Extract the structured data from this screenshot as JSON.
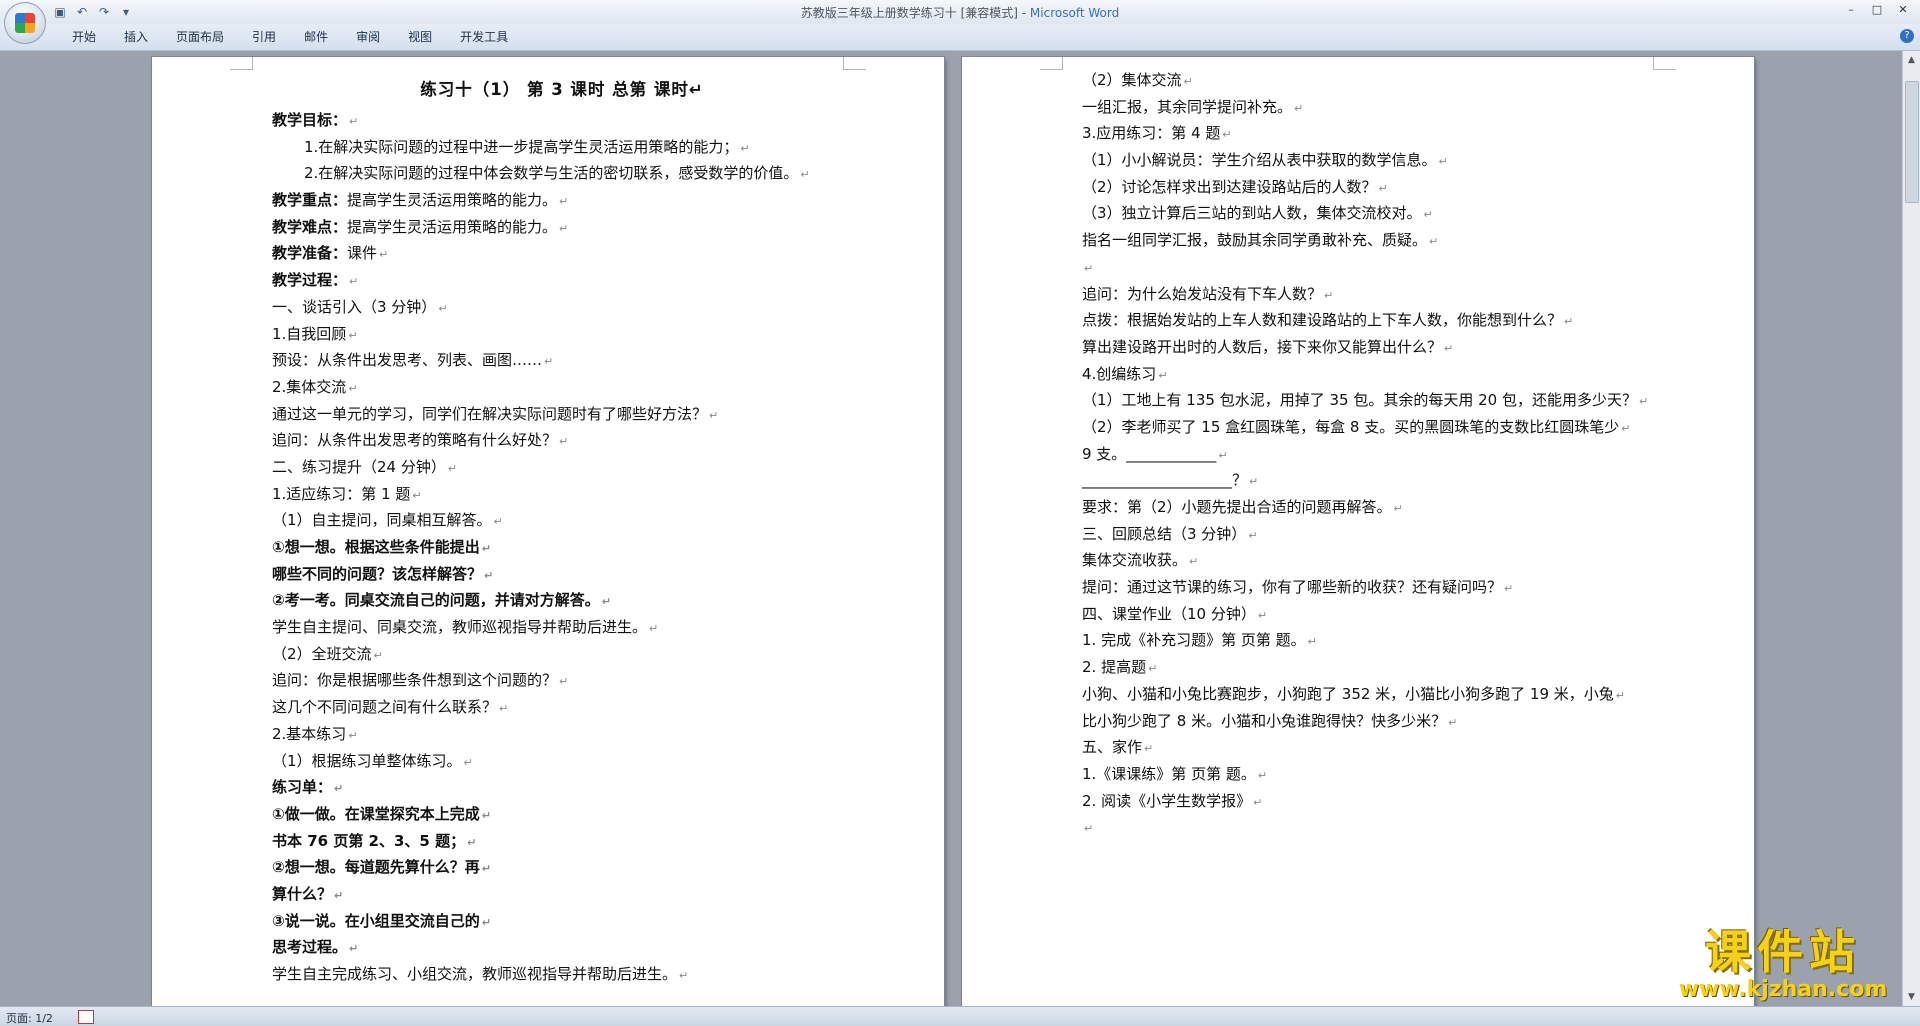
{
  "window": {
    "title_doc": "苏教版三年级上册数学练习十 [兼容模式] - ",
    "title_app": "Microsoft Word",
    "qat": [
      "save-icon",
      "undo-icon",
      "redo-icon",
      "customize-icon"
    ],
    "controls": [
      "–",
      "□",
      "✕"
    ]
  },
  "ribbon": {
    "tabs": [
      "开始",
      "插入",
      "页面布局",
      "引用",
      "邮件",
      "审阅",
      "视图",
      "开发工具"
    ],
    "help": "?"
  },
  "left_page": {
    "title": "练习十（1）    第 3 课时   总第   课时",
    "lines": [
      {
        "text": "教学目标：",
        "bold_prefix": true
      },
      {
        "text": "1.在解决实际问题的过程中进一步提高学生灵活运用策略的能力；",
        "indent": true
      },
      {
        "text": "2.在解决实际问题的过程中体会数学与生活的密切联系，感受数学的价值。",
        "indent": true
      },
      {
        "prefix": "教学重点：",
        "text": "提高学生灵活运用策略的能力。"
      },
      {
        "prefix": "教学难点：",
        "text": "提高学生灵活运用策略的能力。"
      },
      {
        "prefix": "教学准备：",
        "text": "课件"
      },
      {
        "prefix": "教学过程：",
        "text": ""
      },
      {
        "text": "一、谈话引入（3 分钟）"
      },
      {
        "text": "1.自我回顾"
      },
      {
        "text": "预设：从条件出发思考、列表、画图……"
      },
      {
        "text": "2.集体交流"
      },
      {
        "text": "通过这一单元的学习，同学们在解决实际问题时有了哪些好方法？"
      },
      {
        "text": "追问：从条件出发思考的策略有什么好处？"
      },
      {
        "text": "二、练习提升（24 分钟）"
      },
      {
        "text": "1.适应练习：第 1 题"
      },
      {
        "text": "（1）自主提问，同桌相互解答。"
      },
      {
        "text": "①想一想。根据这些条件能提出",
        "bold": true
      },
      {
        "text": "哪些不同的问题？该怎样解答？",
        "bold": true
      },
      {
        "text": "②考一考。同桌交流自己的问题，并请对方解答。",
        "bold": true
      },
      {
        "text": "学生自主提问、同桌交流，教师巡视指导并帮助后进生。"
      },
      {
        "text": "（2）全班交流"
      },
      {
        "text": "追问：你是根据哪些条件想到这个问题的？"
      },
      {
        "text": "这几个不同问题之间有什么联系？"
      },
      {
        "text": "2.基本练习"
      },
      {
        "text": "（1）根据练习单整体练习。"
      },
      {
        "text": "练习单：",
        "bold": true
      },
      {
        "text": "①做一做。在课堂探究本上完成",
        "bold": true
      },
      {
        "text": "书本 76 页第 2、3、5 题；",
        "bold": true
      },
      {
        "text": "②想一想。每道题先算什么？再",
        "bold": true
      },
      {
        "text": "算什么？",
        "bold": true
      },
      {
        "text": "③说一说。在小组里交流自己的",
        "bold": true
      },
      {
        "text": "思考过程。",
        "bold": true
      },
      {
        "text": "学生自主完成练习、小组交流，教师巡视指导并帮助后进生。"
      }
    ]
  },
  "right_page": {
    "lines": [
      {
        "text": "（2）集体交流"
      },
      {
        "text": "一组汇报，其余同学提问补充。"
      },
      {
        "text": "3.应用练习：第 4 题"
      },
      {
        "text": "（1）小小解说员：学生介绍从表中获取的数学信息。"
      },
      {
        "text": "（2）讨论怎样求出到达建设路站后的人数？"
      },
      {
        "text": "（3）独立计算后三站的到站人数，集体交流校对。"
      },
      {
        "text": "指名一组同学汇报，鼓励其余同学勇敢补充、质疑。"
      },
      {
        "text": ""
      },
      {
        "text": "追问：为什么始发站没有下车人数？"
      },
      {
        "text": "点拨：根据始发站的上车人数和建设路站的上下车人数，你能想到什么？"
      },
      {
        "text": "算出建设路开出时的人数后，接下来你又能算出什么？"
      },
      {
        "text": "4.创编练习"
      },
      {
        "text": "（1）工地上有 135 包水泥，用掉了 35 包。其余的每天用 20 包，还能用多少天？"
      },
      {
        "text": "（2）李老师买了 15 盒红圆珠笔，每盒 8 支。买的黑圆珠笔的支数比红圆珠笔少"
      },
      {
        "text": "9 支。____________"
      },
      {
        "text": "____________________？"
      },
      {
        "text": "要求：第（2）小题先提出合适的问题再解答。"
      },
      {
        "text": "三、回顾总结（3 分钟）"
      },
      {
        "text": "集体交流收获。"
      },
      {
        "text": "提问：通过这节课的练习，你有了哪些新的收获？还有疑问吗？"
      },
      {
        "text": "四、课堂作业（10 分钟）"
      },
      {
        "text": "1. 完成《补充习题》第   页第   题。"
      },
      {
        "text": "2. 提高题"
      },
      {
        "text": "小狗、小猫和小兔比赛跑步，小狗跑了 352 米，小猫比小狗多跑了 19 米，小兔"
      },
      {
        "text": "比小狗少跑了 8 米。小猫和小兔谁跑得快？快多少米？"
      },
      {
        "text": "五、家作"
      },
      {
        "text": "1.《课课练》第   页第   题。"
      },
      {
        "text": "2. 阅读《小学生数学报》"
      },
      {
        "text": ""
      }
    ]
  },
  "paragraph_mark": "↵",
  "statusbar": {
    "page": "页面: 1/2"
  },
  "watermark": {
    "main": "课件站",
    "url": "www.kjzhan.com"
  }
}
